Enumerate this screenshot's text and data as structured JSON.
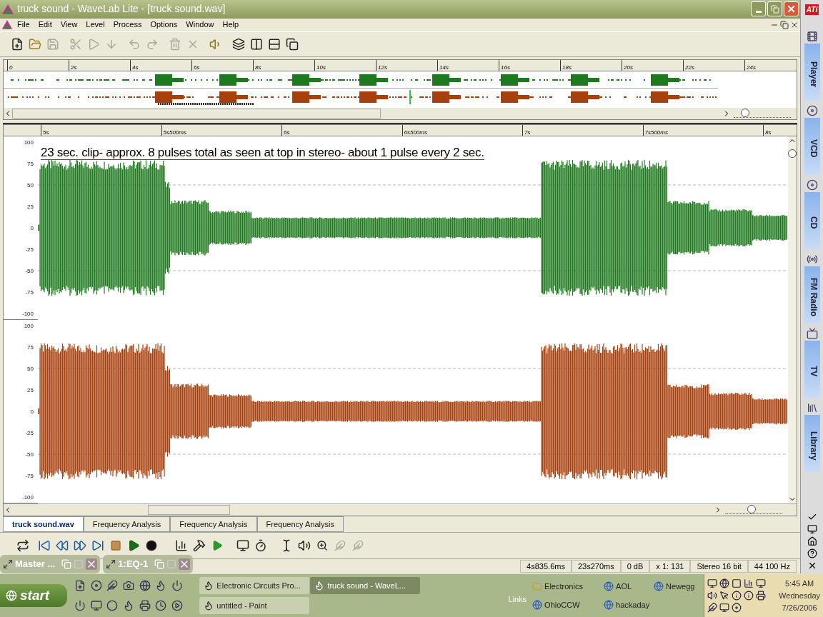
{
  "window": {
    "title": "truck sound - WaveLab Lite - [truck sound.wav]"
  },
  "menu": [
    "File",
    "Edit",
    "View",
    "Level",
    "Process",
    "Options",
    "Window",
    "Help"
  ],
  "overview": {
    "ruler": [
      "0",
      "2s",
      "4s",
      "6s",
      "8s",
      "10s",
      "12s",
      "14s",
      "16s",
      "18s",
      "20s",
      "22s",
      "24s"
    ],
    "tracks": [
      {
        "color": "#1f7a1f"
      },
      {
        "color": "#a8400e"
      }
    ],
    "zoom": {
      "level": 0.15
    }
  },
  "editor": {
    "ruler": [
      "5s",
      "5s500ms",
      "6s",
      "6s500ms",
      "7s",
      "7s500ms",
      "8s"
    ],
    "zoom": {
      "level": 0.45
    },
    "note": "23 sec. clip- approx. 8 pulses total as seen at top in stereo- about 1 pulse every 2 sec.",
    "channels": [
      {
        "color": "#1f7a1f",
        "y_ticks": [
          "100",
          "75",
          "50",
          "25",
          "0",
          "-25",
          "-50",
          "-75",
          "-100"
        ]
      },
      {
        "color": "#a8400e",
        "y_ticks": [
          "100",
          "75",
          "50",
          "25",
          "0",
          "-25",
          "-50",
          "-75",
          "-100"
        ]
      }
    ]
  },
  "tabs": [
    {
      "label": "truck sound.wav",
      "selected": true
    },
    {
      "label": "Frequency Analysis",
      "selected": false
    },
    {
      "label": "Frequency Analysis",
      "selected": false
    },
    {
      "label": "Frequency Analysis",
      "selected": false
    }
  ],
  "floating_bars": [
    {
      "title": "Master ..."
    },
    {
      "title": "1:EQ-1"
    }
  ],
  "status_bar": [
    "4s835.6ms",
    "23s270ms",
    "0 dB",
    "x 1: 131",
    "Stereo 16 bit",
    "44 100 Hz"
  ],
  "side_panel": {
    "logo": "ATI",
    "items": [
      "Player",
      "VCD",
      "CD",
      "FM Radio",
      "TV",
      "Library"
    ]
  },
  "taskbar": {
    "start": "start",
    "tasks": [
      {
        "label": "Electronic Circuits Pro...",
        "selected": false
      },
      {
        "label": "truck sound - WaveL...",
        "selected": true
      },
      {
        "label": "untitled - Paint",
        "selected": false
      }
    ],
    "links_label": "Links",
    "links": [
      "Electronics",
      "AOL",
      "Newegg",
      "OhioCCW",
      "hackaday"
    ],
    "clock": {
      "time": "5:45 AM",
      "day": "Wednesday",
      "date": "7/26/2006"
    }
  }
}
